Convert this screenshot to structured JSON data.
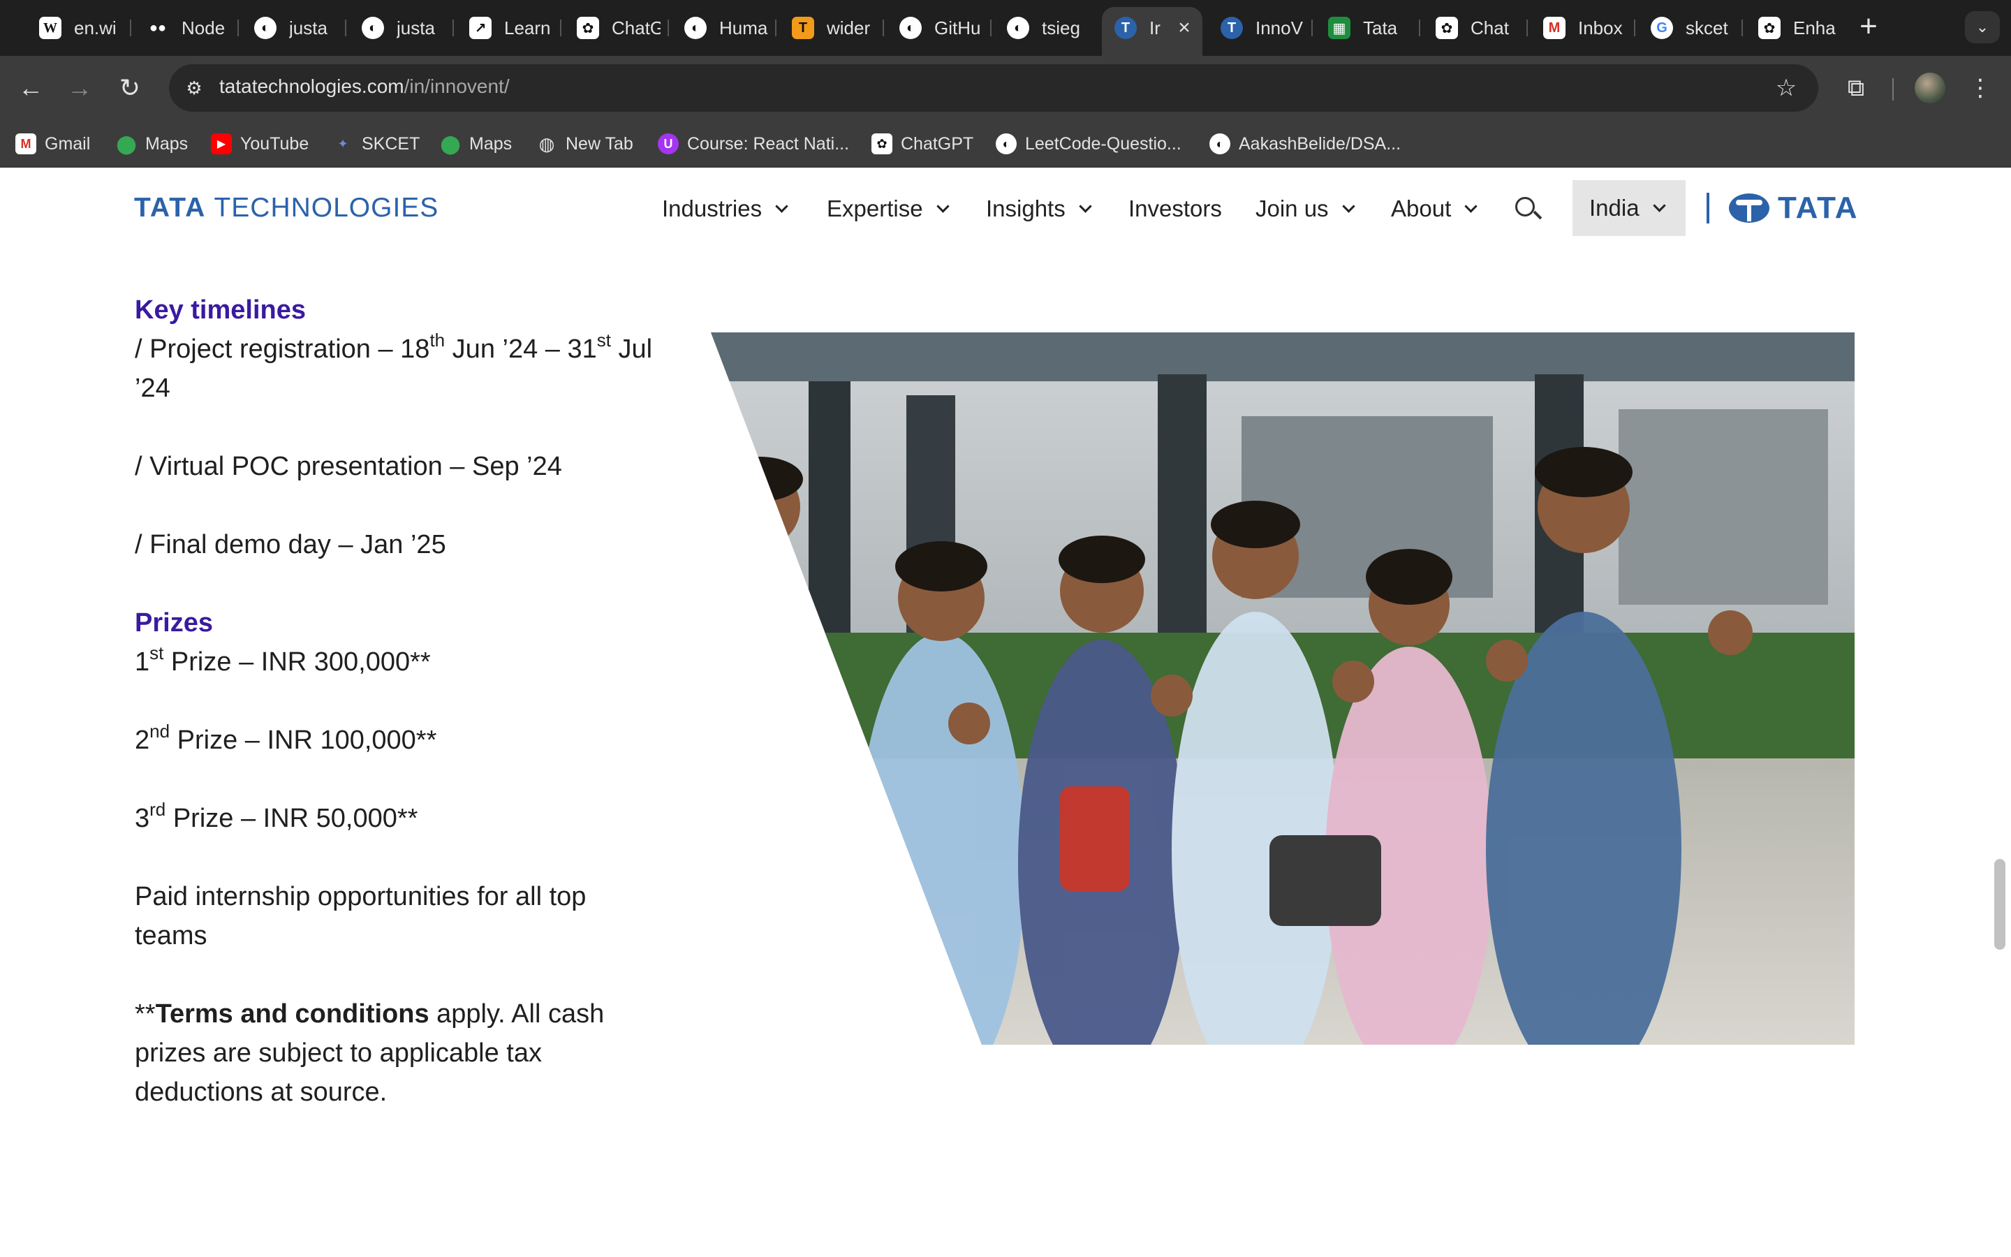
{
  "browser": {
    "tabs": [
      {
        "title": "en.wi",
        "icon": "wikipedia-icon"
      },
      {
        "title": "Node",
        "icon": "medium-icon"
      },
      {
        "title": "justa",
        "icon": "github-icon"
      },
      {
        "title": "justa",
        "icon": "github-icon"
      },
      {
        "title": "Learn",
        "icon": "chart-icon"
      },
      {
        "title": "ChatG",
        "icon": "chatgpt-icon"
      },
      {
        "title": "Huma",
        "icon": "github-icon"
      },
      {
        "title": "wider",
        "icon": "tensorflow-icon"
      },
      {
        "title": "GitHu",
        "icon": "github-icon"
      },
      {
        "title": "tsieg",
        "icon": "github-icon"
      },
      {
        "title": "Ir",
        "icon": "tata-icon"
      },
      {
        "title": "InnoV",
        "icon": "tata-icon"
      },
      {
        "title": "Tata",
        "icon": "sheets-icon"
      },
      {
        "title": "Chat",
        "icon": "chatgpt-icon"
      },
      {
        "title": "Inbox",
        "icon": "gmail-icon"
      },
      {
        "title": "skcet",
        "icon": "google-icon"
      },
      {
        "title": "Enha",
        "icon": "chatgpt-icon"
      }
    ],
    "url_domain": "tatatechnologies.com",
    "url_path": "/in/innovent/",
    "bookmarks": [
      {
        "label": "Gmail",
        "icon": "gmail-icon"
      },
      {
        "label": "Maps",
        "icon": "maps-icon"
      },
      {
        "label": "YouTube",
        "icon": "youtube-icon"
      },
      {
        "label": "SKCET",
        "icon": "skcet-icon"
      },
      {
        "label": "Maps",
        "icon": "maps-icon"
      },
      {
        "label": "New Tab",
        "icon": "globe-icon"
      },
      {
        "label": "Course: React Nati...",
        "icon": "udemy-icon"
      },
      {
        "label": "ChatGPT",
        "icon": "chatgpt-icon"
      },
      {
        "label": "LeetCode-Questio...",
        "icon": "github-icon"
      },
      {
        "label": "AakashBelide/DSA...",
        "icon": "github-icon"
      }
    ]
  },
  "site": {
    "logo_bold": "TATA",
    "logo_rest": "TECHNOLOGIES",
    "nav": [
      {
        "label": "Industries",
        "dropdown": true
      },
      {
        "label": "Expertise",
        "dropdown": true
      },
      {
        "label": "Insights",
        "dropdown": true
      },
      {
        "label": "Investors",
        "dropdown": false
      },
      {
        "label": "Join us",
        "dropdown": true
      },
      {
        "label": "About",
        "dropdown": true
      }
    ],
    "country": "India",
    "brand_word": "TATA"
  },
  "content": {
    "timelines_heading": "Key timelines",
    "timeline_1": {
      "a": "/ Project registration – 18",
      "sup1": "th",
      "b": " Jun ’24 – 31",
      "sup2": "st",
      "c": " Jul ’24"
    },
    "timeline_2": "/ Virtual POC presentation – Sep ’24",
    "timeline_3": "/ Final demo day – Jan ’25",
    "prizes_heading": "Prizes",
    "prize_1": {
      "num": "1",
      "sup": "st",
      "text": " Prize – INR 300,000**"
    },
    "prize_2": {
      "num": "2",
      "sup": "nd",
      "text": " Prize – INR 100,000**"
    },
    "prize_3": {
      "num": "3",
      "sup": "rd",
      "text": " Prize – INR 50,000**"
    },
    "internship": "Paid internship opportunities for all top teams",
    "terms_prefix": "**",
    "terms_bold": "Terms and conditions",
    "terms_rest": " apply. All cash prizes are subject to applicable tax deductions at source."
  },
  "colors": {
    "brand_blue": "#2b62aa",
    "heading_purple": "#3a1aa0",
    "chrome_dark": "#1f1f1f",
    "chrome_toolbar": "#3c3c3c"
  }
}
